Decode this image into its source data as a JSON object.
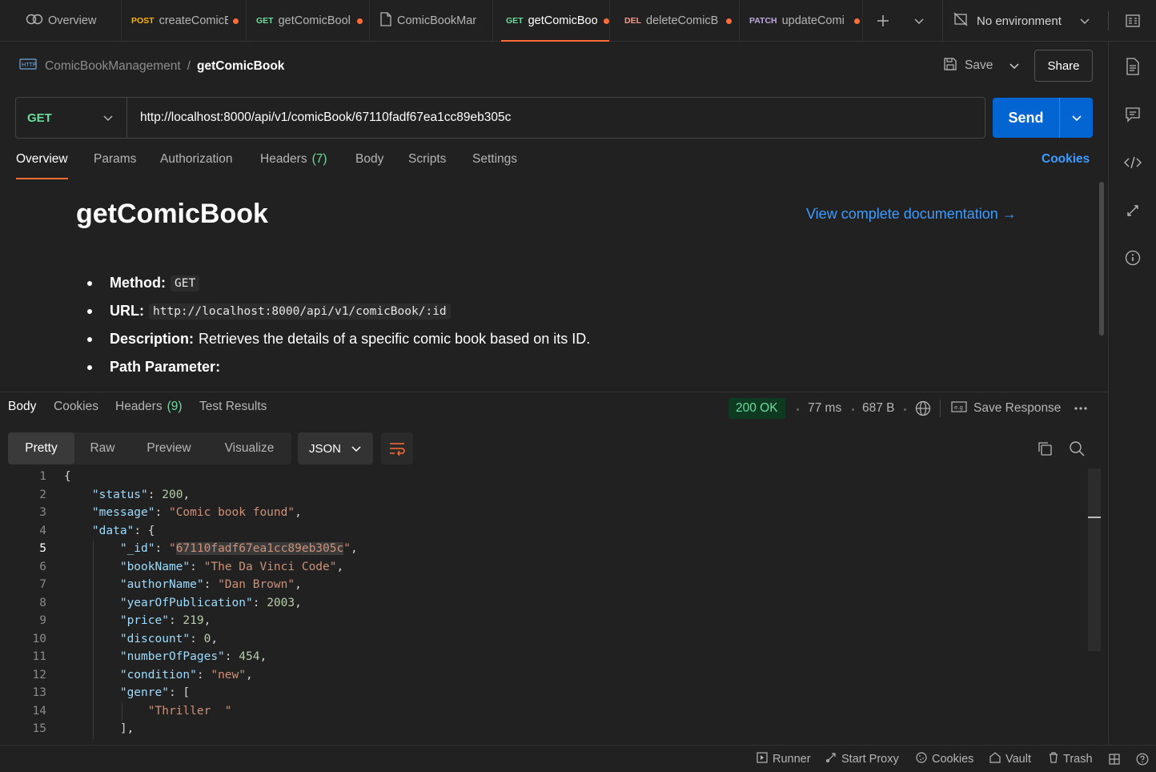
{
  "tabs": {
    "overview_label": "Overview",
    "items": [
      {
        "method": "POST",
        "label": "createComicB"
      },
      {
        "method": "GET",
        "label": "getComicBool"
      },
      {
        "method": "",
        "label": "ComicBookMar"
      },
      {
        "method": "GET",
        "label": "getComicBoo"
      },
      {
        "method": "DEL",
        "label": "deleteComicB"
      },
      {
        "method": "PATCH",
        "label": "updateComi"
      }
    ],
    "environment": "No environment"
  },
  "breadcrumb": {
    "parent": "ComicBookManagement",
    "separator": "/",
    "current": "getComicBook"
  },
  "header": {
    "save_label": "Save",
    "share_label": "Share"
  },
  "request": {
    "method": "GET",
    "url": "http://localhost:8000/api/v1/comicBook/67110fadf67ea1cc89eb305c",
    "send_label": "Send"
  },
  "request_tabs": {
    "overview": "Overview",
    "params": "Params",
    "authorization": "Authorization",
    "headers": "Headers",
    "headers_count": "(7)",
    "body": "Body",
    "scripts": "Scripts",
    "settings": "Settings",
    "cookies": "Cookies"
  },
  "doc": {
    "title": "getComicBook",
    "link": "View complete documentation →",
    "method_label": "Method:",
    "method_value": "GET",
    "url_label": "URL:",
    "url_value": "http://localhost:8000/api/v1/comicBook/:id",
    "desc_label": "Description:",
    "desc_value": "Retrieves the details of a specific comic book based on its ID.",
    "path_label": "Path Parameter:"
  },
  "response": {
    "tabs": {
      "body": "Body",
      "cookies": "Cookies",
      "headers": "Headers",
      "headers_count": "(9)",
      "tests": "Test Results"
    },
    "status": "200 OK",
    "time": "77 ms",
    "size": "687 B",
    "save_label": "Save Response",
    "views": [
      "Pretty",
      "Raw",
      "Preview",
      "Visualize"
    ],
    "format": "JSON"
  },
  "code_lines": [
    "{",
    "    \"status\": 200,",
    "    \"message\": \"Comic book found\",",
    "    \"data\": {",
    "        \"_id\": \"67110fadf67ea1cc89eb305c\",",
    "        \"bookName\": \"The Da Vinci Code\",",
    "        \"authorName\": \"Dan Brown\",",
    "        \"yearOfPublication\": 2003,",
    "        \"price\": 219,",
    "        \"discount\": 0,",
    "        \"numberOfPages\": 454,",
    "        \"condition\": \"new\",",
    "        \"genre\": [",
    "            \"Thriller  \"",
    "        ],"
  ],
  "statusbar": {
    "runner": "Runner",
    "proxy": "Start Proxy",
    "cookies": "Cookies",
    "vault": "Vault",
    "trash": "Trash"
  }
}
